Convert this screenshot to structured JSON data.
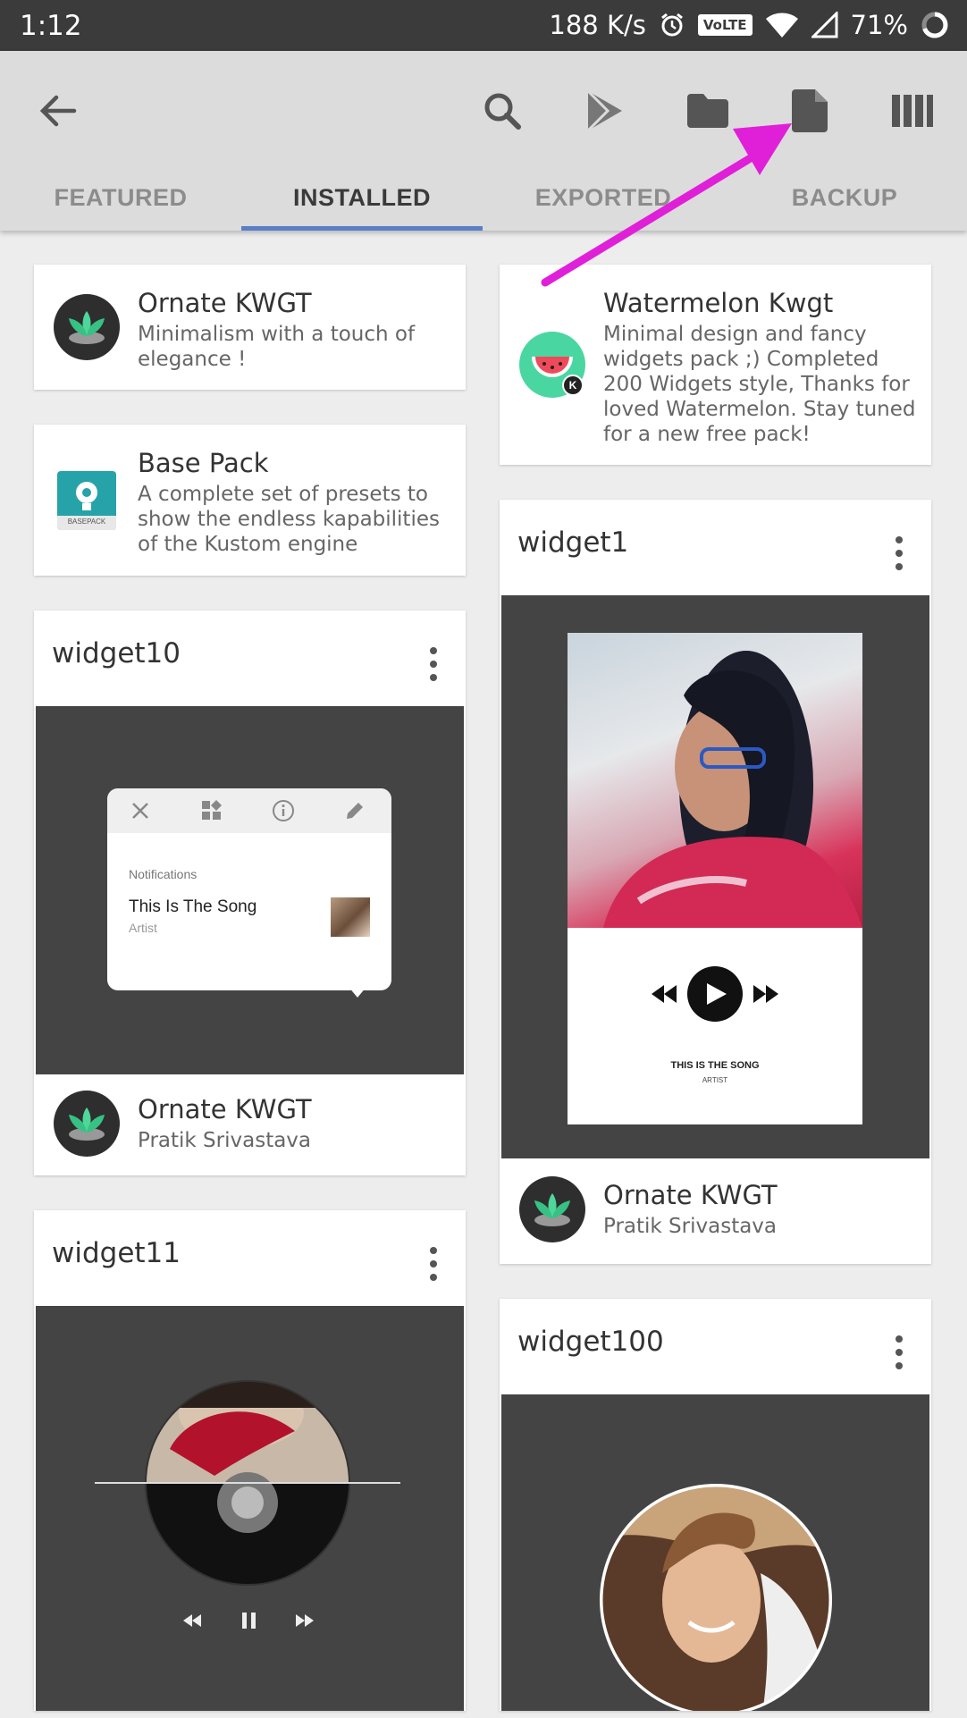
{
  "status_bar": {
    "time": "1:12",
    "net_speed": "188 K/s",
    "volte": "VoLTE",
    "battery": "71%"
  },
  "toolbar": {
    "icons": [
      "back-arrow-icon",
      "search-icon",
      "play-store-icon",
      "folder-icon",
      "file-icon",
      "library-icon"
    ]
  },
  "tabs": [
    {
      "label": "FEATURED"
    },
    {
      "label": "INSTALLED"
    },
    {
      "label": "EXPORTED"
    },
    {
      "label": "BACKUP"
    }
  ],
  "packs": [
    {
      "title": "Ornate KWGT",
      "description": "Minimalism with a touch of elegance !"
    },
    {
      "title": "Base Pack",
      "description": "A complete set of presets to show the endless kapabilities of the Kustom engine",
      "badge": "BASEPACK"
    },
    {
      "title": "Watermelon Kwgt",
      "description": "Minimal design and fancy widgets pack ;) Completed 200 Widgets style, Thanks for loved Watermelon. Stay tuned for a new free pack!",
      "badge": "K"
    }
  ],
  "widgets": [
    {
      "title": "widget10",
      "pack": "Ornate KWGT",
      "author": "Pratik Srivastava",
      "preview": {
        "section": "Notifications",
        "song": "This Is The Song",
        "artist": "Artist"
      }
    },
    {
      "title": "widget1",
      "pack": "Ornate KWGT",
      "author": "Pratik Srivastava",
      "preview": {
        "song": "THIS IS THE SONG",
        "artist": "ARTIST"
      }
    },
    {
      "title": "widget11"
    },
    {
      "title": "widget100"
    }
  ],
  "colors": {
    "tab_indicator": "#5b7ec9",
    "annotation_arrow": "#e020d8",
    "app_bar": "#dcdcdc",
    "status_bar": "#3b3b3b"
  }
}
